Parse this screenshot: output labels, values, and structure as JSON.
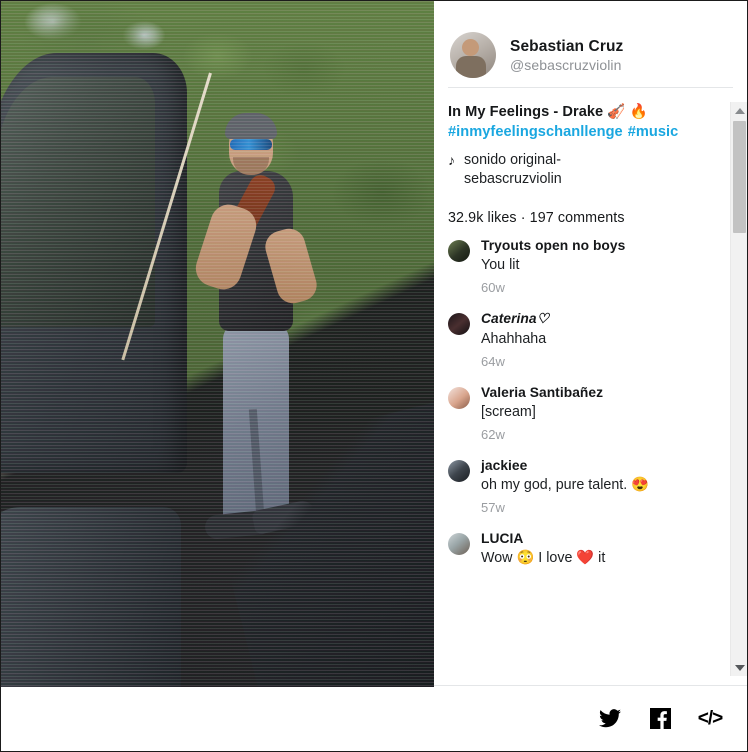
{
  "author": {
    "name": "Sebastian Cruz",
    "handle": "@sebascruzviolin",
    "avatar_icon": "profile-avatar-image"
  },
  "post": {
    "caption": "In My Feelings - Drake 🎻 🔥",
    "hashtags": [
      "#inmyfeelingschanllenge",
      "#music"
    ],
    "music_note_icon": "music-note-icon",
    "music_title": "sonido original-sebascruzviolin",
    "stats": "32.9k likes · 197 comments",
    "hashtag_color": "#1aa7e0"
  },
  "comments": [
    {
      "avatar_icon": "commenter-avatar",
      "name": "Tryouts open no boys",
      "text": "You lit",
      "time": "60w",
      "name_italic": false
    },
    {
      "avatar_icon": "commenter-avatar",
      "name": "Caterina♡",
      "text": "Ahahhaha",
      "time": "64w",
      "name_italic": true
    },
    {
      "avatar_icon": "commenter-avatar",
      "name": "Valeria Santibañez",
      "text": "[scream]",
      "time": "62w",
      "name_italic": false
    },
    {
      "avatar_icon": "commenter-avatar",
      "name": "jackiee",
      "text": "oh my god, pure talent. 😍",
      "time": "57w",
      "name_italic": false
    },
    {
      "avatar_icon": "commenter-avatar",
      "name": "LUCIA",
      "text": "Wow 😳 I love ❤️ it",
      "time": "",
      "name_italic": false
    }
  ],
  "scrollbar": {
    "up_arrow_icon": "scroll-up-arrow-icon",
    "down_arrow_icon": "scroll-down-arrow-icon",
    "thumb_icon": "scrollbar-thumb"
  },
  "footer": {
    "share_buttons": [
      {
        "icon": "twitter-icon",
        "label": "Twitter"
      },
      {
        "icon": "facebook-icon",
        "label": "Facebook"
      },
      {
        "icon": "embed-code-icon",
        "label": "</>"
      }
    ]
  },
  "video": {
    "description_icon": "video-player-frame"
  }
}
